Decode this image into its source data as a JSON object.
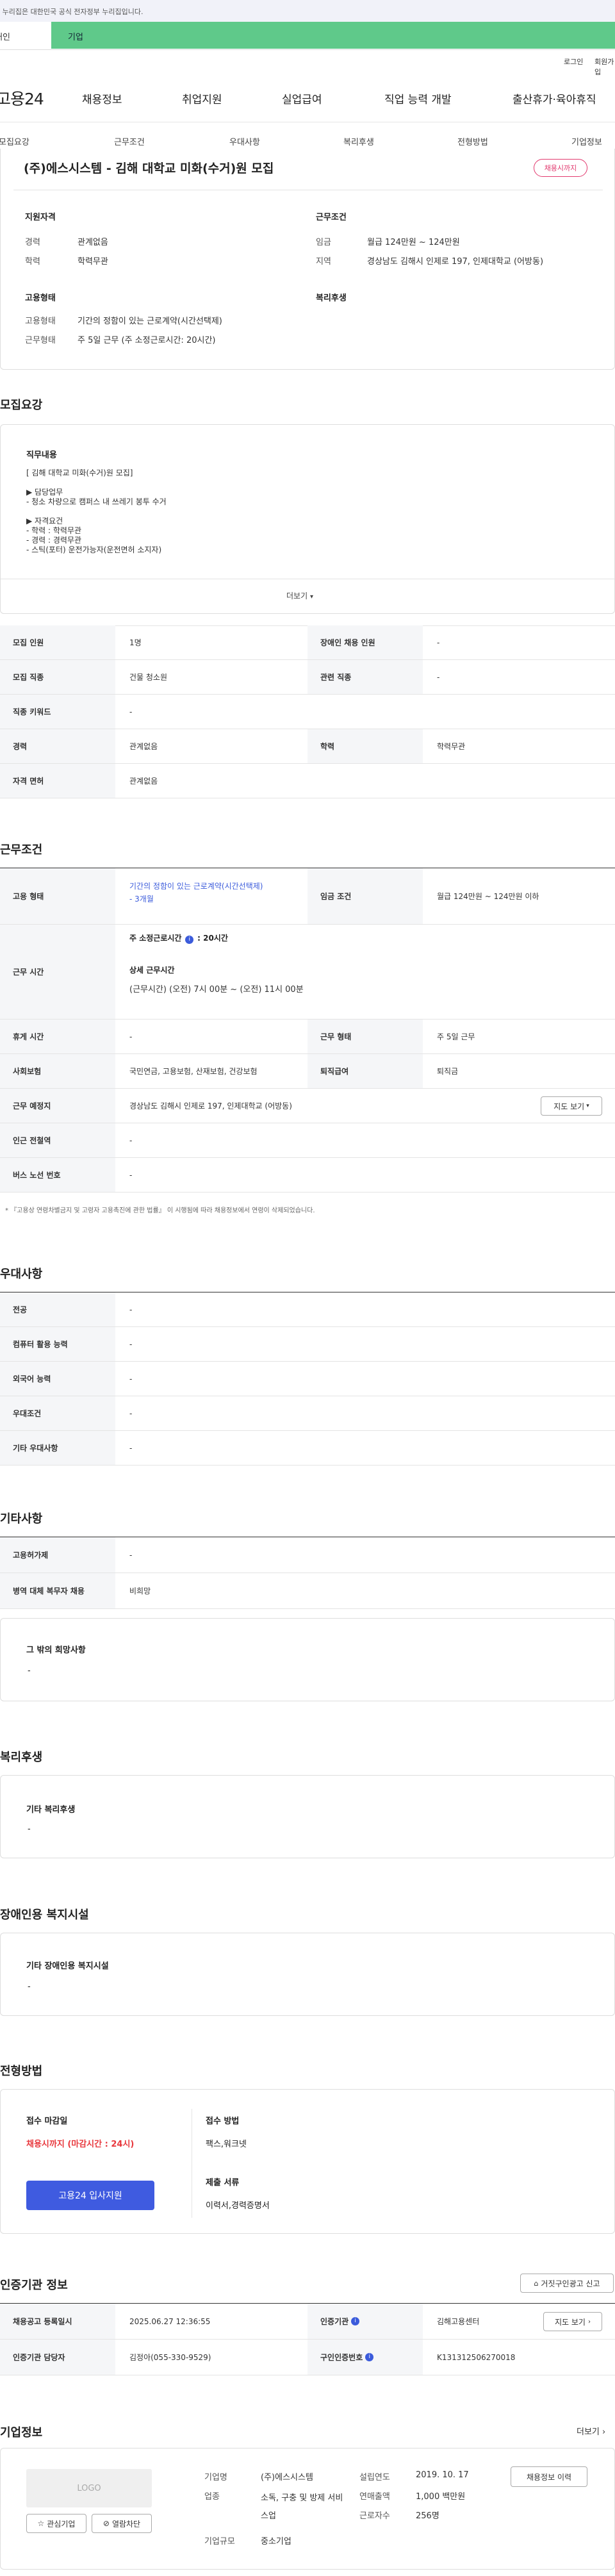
{
  "gov_notice": "이 누리집은 대한민국 공식 전자정부 누리집입니다.",
  "user_tabs": {
    "individual": "개인",
    "business": "기업"
  },
  "util": {
    "login": "로그인",
    "join": "회원가입"
  },
  "gnb": {
    "logo": "고용24",
    "items": [
      "채용정보",
      "취업지원",
      "실업급여",
      "직업 능력 개발",
      "출산휴가·육아휴직"
    ]
  },
  "subnav": [
    "모집요강",
    "근무조건",
    "우대사항",
    "복리후생",
    "전형방법",
    "기업정보"
  ],
  "summary": {
    "title": "(주)에스시스템 - 김해 대학교 미화(수거)원 모집",
    "badge": "채용시까지",
    "qual_title": "지원자격",
    "career_label": "경력",
    "career_value": "관계없음",
    "edu_label": "학력",
    "edu_value": "학력무관",
    "work_title": "근무조건",
    "wage_label": "임금",
    "wage_value": "월급 124만원 ~ 124만원",
    "region_label": "지역",
    "region_value": "경상남도 김해시 인제로 197, 인제대학교 (어방동)",
    "emp_title": "고용형태",
    "emptype_label": "고용형태",
    "emptype_value": "기간의 정함이 있는 근로계약(시간선택제)",
    "workform_label": "근무형태",
    "workform_value": "주 5일 근무 (주 소정근로시간: 20시간)",
    "welfare_title": "복리후생"
  },
  "recruit": {
    "title": "모집요강",
    "duty_title": "직무내용",
    "duty_lines": [
      "[ 김해 대학교 미화(수거)원 모집]",
      "",
      "▶ 담당업무",
      "- 청소 차량으로 캠퍼스 내 쓰레기 봉투 수거",
      "",
      "▶ 자격요건",
      "- 학력 : 학력무관",
      "- 경력 : 경력무관",
      "- 스틱(포터) 운전가능자(운전면허 소지자)"
    ],
    "more": "더보기",
    "rows": [
      {
        "l1": "모집 인원",
        "v1": "1명",
        "l2": "장애인 채용 인원",
        "v2": "-"
      },
      {
        "l1": "모집 직종",
        "v1": "건물 청소원",
        "l2": "관련 직종",
        "v2": "-"
      },
      {
        "l1": "직종 키워드",
        "v1": "-"
      },
      {
        "l1": "경력",
        "v1": "관계없음",
        "l2": "학력",
        "v2": "학력무관"
      },
      {
        "l1": "자격 면허",
        "v1": "관계없음"
      }
    ]
  },
  "conditions": {
    "title": "근무조건",
    "emp_label": "고용 형태",
    "emp_value": "기간의 정함이 있는 근로계약(시간선택제)",
    "emp_sub": "- 3개월",
    "wage_label": "임금 조건",
    "wage_value": "월급 124만원 ~ 124만원 이하",
    "hours_label": "근무 시간",
    "hours_week": "주 소정근로시간",
    "hours_week_value": ": 20시간",
    "hours_detail_title": "상세 근무시간",
    "hours_detail": "(근무시간) (오전) 7시 00분 ~ (오전) 11시 00분",
    "break_label": "휴게 시간",
    "break_value": "-",
    "form_label": "근무 형태",
    "form_value": "주 5일 근무",
    "ins_label": "사회보험",
    "ins_value": "국민연금, 고용보험, 산재보험, 건강보험",
    "retire_label": "퇴직급여",
    "retire_value": "퇴직금",
    "place_label": "근무 예정지",
    "place_value": "경상남도 김해시 인제로 197, 인제대학교 (어방동)",
    "map_btn": "지도 보기",
    "subway_label": "인근 전철역",
    "subway_value": "-",
    "bus_label": "버스 노선 번호",
    "bus_value": "-",
    "note": "* 『고용상 연령차별금지 및 고령자 고용촉진에 관한 법률』 이 시행됨에 따라 채용정보에서 연령이 삭제되었습니다."
  },
  "preference": {
    "title": "우대사항",
    "rows": [
      {
        "l": "전공",
        "v": "-"
      },
      {
        "l": "컴퓨터 활용 능력",
        "v": "-"
      },
      {
        "l": "외국어 능력",
        "v": "-"
      },
      {
        "l": "우대조건",
        "v": "-"
      },
      {
        "l": "기타 우대사항",
        "v": "-"
      }
    ]
  },
  "etc": {
    "title": "기타사항",
    "rows": [
      {
        "l": "고용허가제",
        "v": "-"
      },
      {
        "l": "병역 대체 복무자 채용",
        "v": "비희망"
      }
    ],
    "hope_title": "그 밖의 희망사항",
    "hope_value": "-"
  },
  "welfare": {
    "title": "복리후생",
    "box_title": "기타 복리후생",
    "box_value": "-"
  },
  "disability": {
    "title": "장애인용 복지시설",
    "box_title": "기타 장애인용 복지시설",
    "box_value": "-"
  },
  "process": {
    "title": "전형방법",
    "deadline_title": "접수 마감일",
    "deadline_value": "채용시까지 (마감시간 : 24시)",
    "apply_btn": "고용24 입사지원",
    "method_title": "접수 방법",
    "method_value": "팩스,워크넷",
    "docs_title": "제출 서류",
    "docs_value": "이력서,경력증명서"
  },
  "agency": {
    "title": "인증기관 정보",
    "report_btn": "거짓구인광고 신고",
    "reg_label": "채용공고 등록일시",
    "reg_value": "2025.06.27 12:36:55",
    "org_label": "인증기관",
    "org_value": "김해고용센터",
    "map_btn": "지도 보기",
    "mgr_label": "인증기관 담당자",
    "mgr_value": "김정아(055-330-9529)",
    "num_label": "구인인증번호",
    "num_value": "K131312506270018"
  },
  "company": {
    "title": "기업정보",
    "more": "더보기",
    "logo": "LOGO",
    "fav_btn": "관심기업",
    "block_btn": "열람차단",
    "name_label": "기업명",
    "name_value": "(주)에스시스템",
    "ind_label": "업종",
    "ind_value": "소독, 구충 및 방제 서비스업",
    "scale_label": "기업규모",
    "scale_value": "중소기업",
    "year_label": "설립연도",
    "year_value": "2019. 10. 17",
    "sales_label": "연매출액",
    "sales_value": "1,000 백만원",
    "emp_label": "근로자수",
    "emp_value": "256명",
    "history_btn": "채용정보 이력"
  }
}
